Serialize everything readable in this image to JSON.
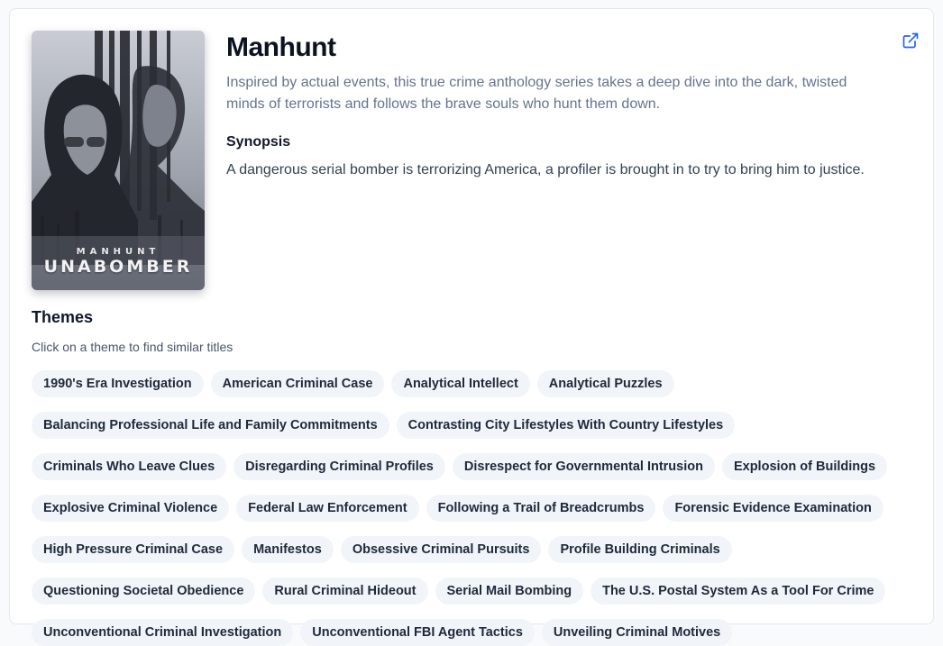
{
  "show": {
    "title": "Manhunt",
    "tagline": "Inspired by actual events, this true crime anthology series takes a deep dive into the dark, twisted minds of terrorists and follows the brave souls who hunt them down.",
    "synopsis_heading": "Synopsis",
    "synopsis": "A dangerous serial bomber is terrorizing America, a profiler is brought in to try to bring him to justice.",
    "poster": {
      "subtitle": "MANHUNT",
      "title": "UNABOMBER"
    },
    "external_link_icon": "external-link-icon",
    "accent_color": "#2563eb"
  },
  "themes": {
    "heading": "Themes",
    "subheading": "Click on a theme to find similar titles",
    "rows": [
      [
        "1990's Era Investigation",
        "American Criminal Case",
        "Analytical Intellect",
        "Analytical Puzzles"
      ],
      [
        "Balancing Professional Life and Family Commitments",
        "Contrasting City Lifestyles With Country Lifestyles"
      ],
      [
        "Criminals Who Leave Clues",
        "Disregarding Criminal Profiles",
        "Disrespect for Governmental Intrusion",
        "Explosion of Buildings"
      ],
      [
        "Explosive Criminal Violence",
        "Federal Law Enforcement",
        "Following a Trail of Breadcrumbs",
        "Forensic Evidence Examination"
      ],
      [
        "High Pressure Criminal Case",
        "Manifestos",
        "Obsessive Criminal Pursuits",
        "Profile Building Criminals"
      ],
      [
        "Questioning Societal Obedience",
        "Rural Criminal Hideout",
        "Serial Mail Bombing",
        "The U.S. Postal System As a Tool For Crime"
      ],
      [
        "Unconventional Criminal Investigation",
        "Unconventional FBI Agent Tactics",
        "Unveiling Criminal Motives"
      ]
    ]
  }
}
